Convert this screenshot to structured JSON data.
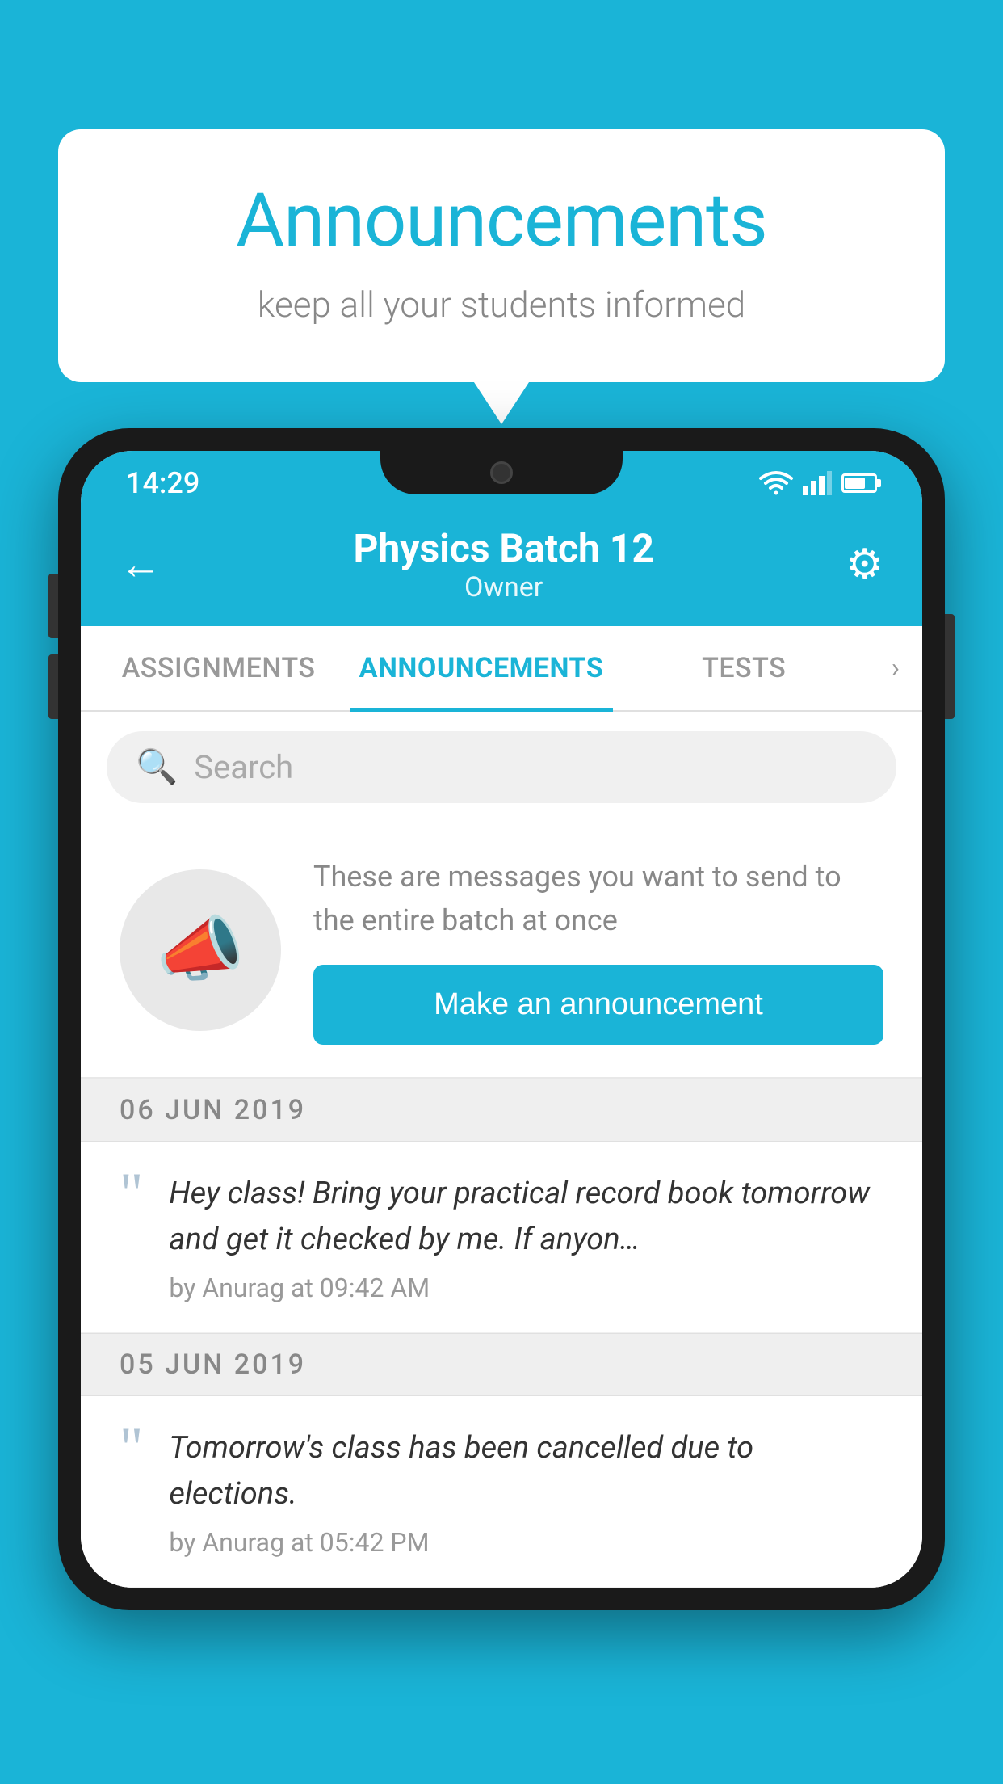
{
  "bubble": {
    "title": "Announcements",
    "subtitle": "keep all your students informed"
  },
  "statusBar": {
    "time": "14:29",
    "wifi": "wifi",
    "signal": "signal",
    "battery": "battery"
  },
  "header": {
    "title": "Physics Batch 12",
    "subtitle": "Owner",
    "back": "←",
    "gear": "⚙"
  },
  "tabs": [
    {
      "label": "ASSIGNMENTS",
      "active": false
    },
    {
      "label": "ANNOUNCEMENTS",
      "active": true
    },
    {
      "label": "TESTS",
      "active": false
    }
  ],
  "search": {
    "placeholder": "Search"
  },
  "intro": {
    "description": "These are messages you want to send to the entire batch at once",
    "buttonLabel": "Make an announcement"
  },
  "announcements": [
    {
      "date": "06  JUN  2019",
      "text": "Hey class! Bring your practical record book tomorrow and get it checked by me. If anyon…",
      "meta": "by Anurag at 09:42 AM"
    },
    {
      "date": "05  JUN  2019",
      "text": "Tomorrow's class has been cancelled due to elections.",
      "meta": "by Anurag at 05:42 PM"
    }
  ],
  "colors": {
    "primary": "#1ab4d7",
    "white": "#ffffff",
    "lightGray": "#efefef",
    "darkText": "#333333",
    "mutedText": "#888888"
  }
}
